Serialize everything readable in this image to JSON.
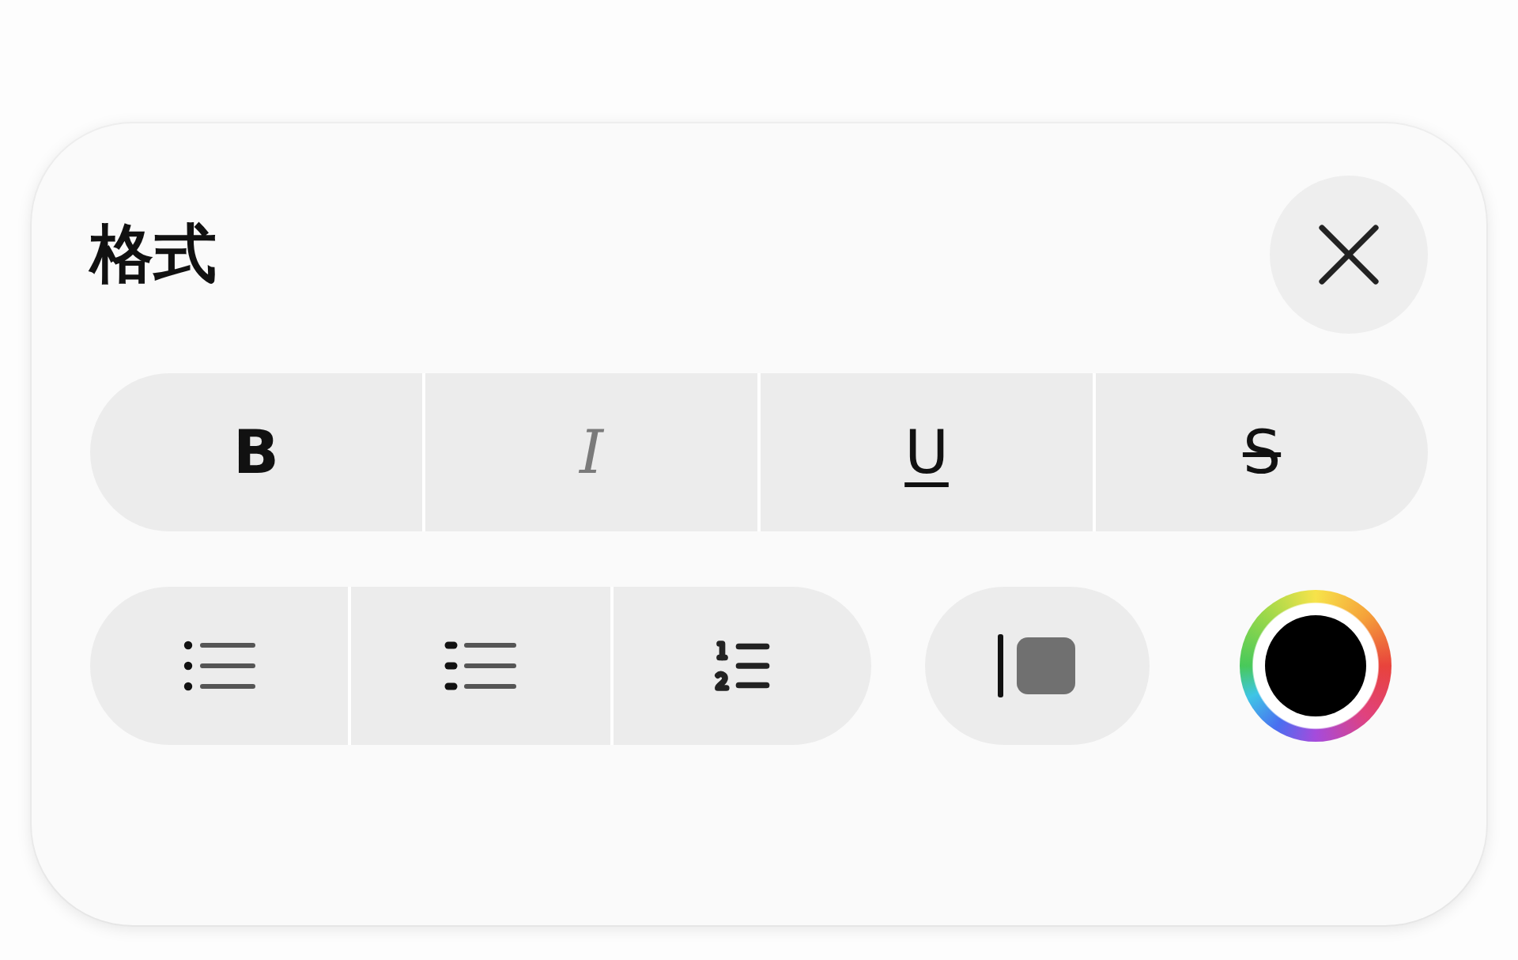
{
  "title": "格式",
  "text_styles": [
    {
      "kind": "bold",
      "label": "B"
    },
    {
      "kind": "italic",
      "label": "I"
    },
    {
      "kind": "underline",
      "label": "U"
    },
    {
      "kind": "strikethrough",
      "label": "S"
    }
  ],
  "list_styles": [
    {
      "kind": "bullet"
    },
    {
      "kind": "dash"
    },
    {
      "kind": "numbered"
    }
  ],
  "color_well": {
    "color": "#000000"
  }
}
